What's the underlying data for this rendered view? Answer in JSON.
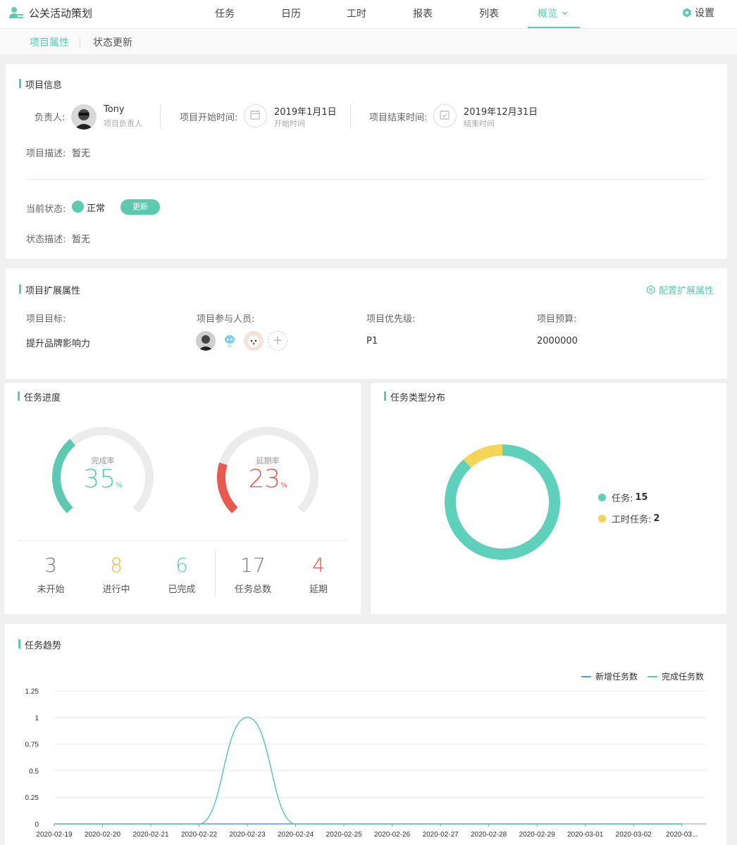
{
  "app": {
    "title": "公关活动策划"
  },
  "nav": {
    "items": [
      "任务",
      "日历",
      "工时",
      "报表",
      "列表",
      "概览"
    ],
    "settings_label": "设置"
  },
  "subtabs": [
    "项目属性",
    "状态更新"
  ],
  "project_info": {
    "section_title": "项目信息",
    "owner_label": "负责人:",
    "owner_name": "Tony",
    "owner_role": "项目负责人",
    "start_label": "项目开始时间:",
    "start_date": "2019年1月1日",
    "start_sub": "开始时间",
    "end_label": "项目结束时间:",
    "end_date": "2019年12月31日",
    "end_sub": "结束时间",
    "desc_label": "项目描述:",
    "desc_value": "暂无",
    "status_label": "当前状态:",
    "status_value": "正常",
    "status_color": "#5cc9b0",
    "update_button": "更新",
    "status_desc_label": "状态描述:",
    "status_desc_value": "暂无"
  },
  "extended": {
    "section_title": "项目扩展属性",
    "config_link": "配置扩展属性",
    "goal_label": "项目目标:",
    "goal_value": "提升品牌影响力",
    "members_label": "项目参与人员:",
    "priority_label": "项目优先级:",
    "priority_value": "P1",
    "budget_label": "项目预算:",
    "budget_value": "2000000"
  },
  "progress": {
    "section_title": "任务进度",
    "completion_label": "完成率",
    "completion_value": "35",
    "completion_fraction": 0.35,
    "delay_label": "延期率",
    "delay_value": "23",
    "delay_fraction": 0.23,
    "percent_sign": "%",
    "stats": [
      {
        "value": "3",
        "label": "未开始",
        "color": "#777777"
      },
      {
        "value": "8",
        "label": "进行中",
        "color": "#f5b942"
      },
      {
        "value": "6",
        "label": "已完成",
        "color": "#5cc9b0"
      },
      {
        "value": "17",
        "label": "任务总数",
        "color": "#777777"
      },
      {
        "value": "4",
        "label": "延期",
        "color": "#e85a50"
      }
    ]
  },
  "distribution": {
    "section_title": "任务类型分布",
    "items": [
      {
        "label": "任务:",
        "value": "15",
        "color": "#5fd1ba"
      },
      {
        "label": "工时任务:",
        "value": "2",
        "color": "#f6d456"
      }
    ]
  },
  "trend": {
    "section_title": "任务趋势",
    "legend": [
      {
        "name": "新增任务数",
        "color": "#5b9bd5"
      },
      {
        "name": "完成任务数",
        "color": "#5cc9b0"
      }
    ]
  },
  "chart_data": {
    "type": "line",
    "x": [
      "2020-02-19",
      "2020-02-20",
      "2020-02-21",
      "2020-02-22",
      "2020-02-23",
      "2020-02-24",
      "2020-02-25",
      "2020-02-26",
      "2020-02-27",
      "2020-02-28",
      "2020-02-29",
      "2020-03-01",
      "2020-03-02",
      "2020-03..."
    ],
    "series": [
      {
        "name": "新增任务数",
        "values": [
          0,
          0,
          0,
          0,
          0,
          0,
          0,
          0,
          0,
          0,
          0,
          0,
          0,
          0
        ],
        "color": "#5b9bd5"
      },
      {
        "name": "完成任务数",
        "values": [
          0,
          0,
          0,
          0,
          1,
          0,
          0,
          0,
          0,
          0,
          0,
          0,
          0,
          0
        ],
        "color": "#5cc9b0"
      }
    ],
    "yticks": [
      "0",
      "0.25",
      "0.5",
      "0.75",
      "1",
      "1.25"
    ],
    "ylim": [
      0,
      1.25
    ],
    "grid": true,
    "legend_position": "top-right"
  }
}
